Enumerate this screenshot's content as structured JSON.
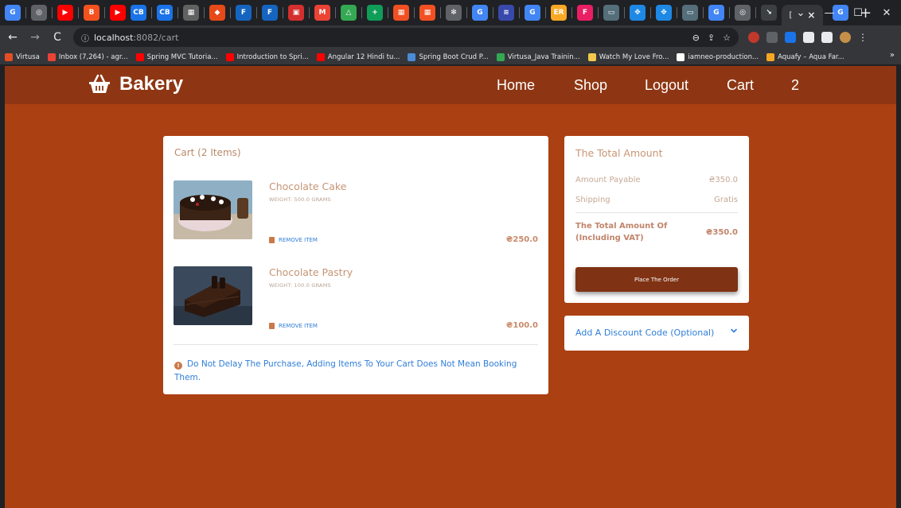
{
  "browser": {
    "tab_close": "×",
    "new_tab": "+",
    "window_controls": {
      "minimize": "—",
      "maximize": "☐",
      "close": "✕"
    },
    "url_host": "localhost",
    "url_path": ":8082/cart",
    "bookmarks": [
      {
        "label": "Virtusa",
        "color": "#e44d26"
      },
      {
        "label": "Inbox (7,264) - agr...",
        "color": "#ea4335"
      },
      {
        "label": "Spring MVC Tutoria...",
        "color": "#ff0000"
      },
      {
        "label": "Introduction to Spri...",
        "color": "#ff0000"
      },
      {
        "label": "Angular 12 Hindi tu...",
        "color": "#ff0000"
      },
      {
        "label": "Spring Boot Crud P...",
        "color": "#4a8bd6"
      },
      {
        "label": "Virtusa_Java Trainin...",
        "color": "#34a853"
      },
      {
        "label": "Watch My Love Fro...",
        "color": "#f2c94c"
      },
      {
        "label": "iamneo-production...",
        "color": "#ffffff"
      },
      {
        "label": "Aquafy – Aqua Far...",
        "color": "#f5a623"
      }
    ]
  },
  "navbar": {
    "brand": "Bakery",
    "links": {
      "home": "Home",
      "shop": "Shop",
      "logout": "Logout",
      "cart": "Cart",
      "cart_count": "2"
    }
  },
  "cart": {
    "title": "Cart (2 Items)",
    "items": [
      {
        "name": "Chocolate Cake",
        "weight": "WEIGHT: 500.0 GRAMS",
        "remove": "REMOVE ITEM",
        "price": "₴250.0"
      },
      {
        "name": "Chocolate Pastry",
        "weight": "WEIGHT: 100.0 GRAMS",
        "remove": "REMOVE ITEM",
        "price": "₴100.0"
      }
    ],
    "notice": "Do Not Delay The Purchase, Adding Items To Your Cart Does Not Mean Booking Them."
  },
  "summary": {
    "title": "The Total Amount",
    "amount_payable_label": "Amount Payable",
    "amount_payable_value": "₴350.0",
    "shipping_label": "Shipping",
    "shipping_value": "Gratis",
    "total_label": "The Total Amount Of (Including VAT)",
    "total_value": "₴350.0",
    "order_button": "Place The Order"
  },
  "discount": {
    "label": "Add A Discount Code (Optional)"
  },
  "colors": {
    "page_bg": "#ab4012",
    "navbar_bg": "#8e3613",
    "button_bg": "#7f3314",
    "link": "#2f7ed8"
  }
}
